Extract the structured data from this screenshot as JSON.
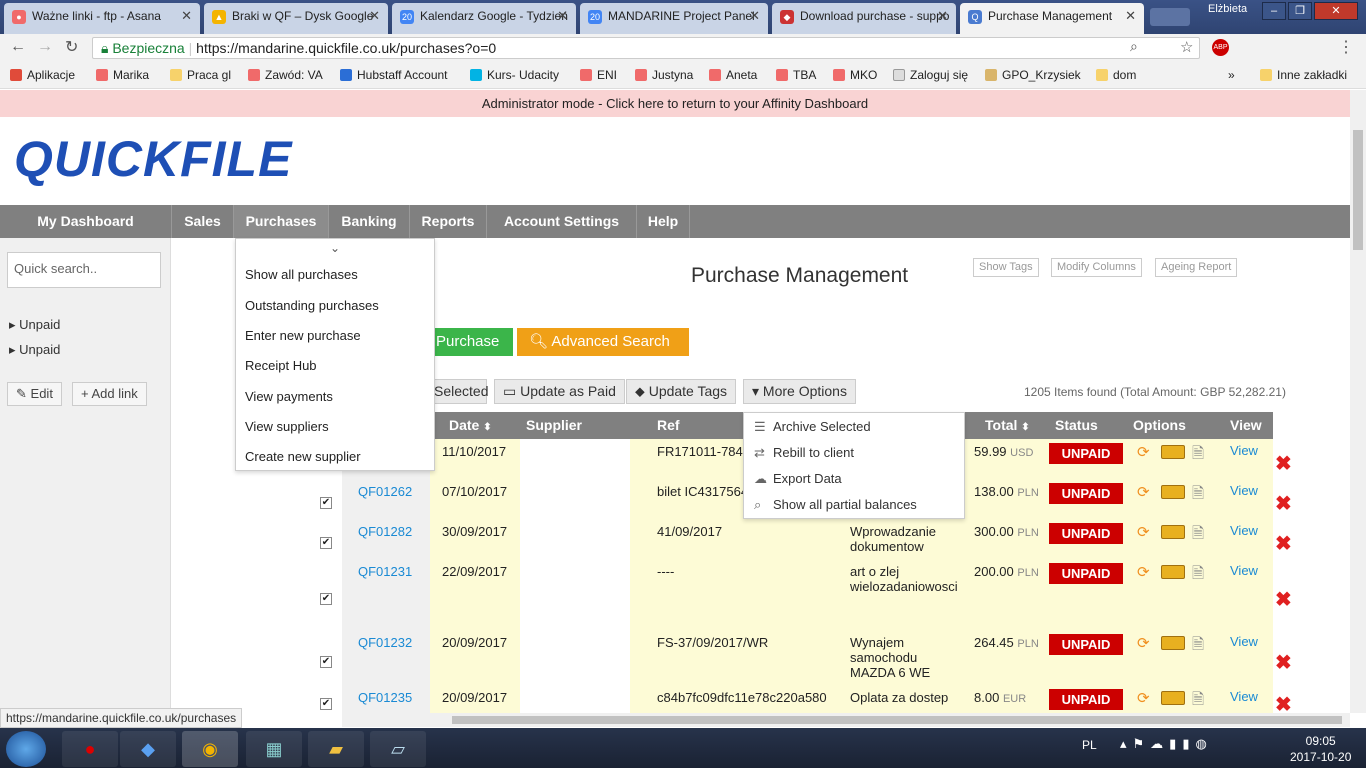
{
  "browser": {
    "tabs": [
      {
        "label": "Ważne linki - ftp - Asana",
        "color": "#f06a6a",
        "active": false
      },
      {
        "label": "Braki w QF – Dysk Google",
        "color": "#f4b400",
        "active": false
      },
      {
        "label": "Kalendarz Google - Tydzień",
        "color": "#4285f4",
        "active": false
      },
      {
        "label": "MANDARINE Project Panel",
        "color": "#4285f4",
        "active": false
      },
      {
        "label": "Download purchase - suppo",
        "color": "#cc3333",
        "active": false
      },
      {
        "label": "Purchase Management",
        "color": "#4a7bd0",
        "active": true
      }
    ],
    "user_label": "Elżbieta",
    "secure_label": "Bezpieczna",
    "url": "https://mandarine.quickfile.co.uk/purchases?o=0",
    "bookmarks": [
      "Aplikacje",
      "Marika",
      "Praca gl",
      "Zawód: VA",
      "Hubstaff Account",
      "Kurs- Udacity",
      "ENI",
      "Justyna",
      "Aneta",
      "TBA",
      "MKO",
      "Zaloguj się",
      "GPO_Krzysiek",
      "dom"
    ],
    "other_bookmarks": "Inne zakładki",
    "status_url": "https://mandarine.quickfile.co.uk/purchases"
  },
  "page": {
    "admin_banner": "Administrator mode - Click here to return to your Affinity Dashboard",
    "logo": "QUICKFILE",
    "nav": [
      "My Dashboard",
      "Sales",
      "Purchases",
      "Banking",
      "Reports",
      "Account Settings",
      "Help"
    ],
    "quick_search_placeholder": "Quick search..",
    "sidebar_links": [
      "Unpaid",
      "Unpaid"
    ],
    "edit_label": "Edit",
    "add_link_label": "Add link",
    "purchases_menu": [
      "Show all purchases",
      "Outstanding purchases",
      "Enter new purchase",
      "Receipt Hub",
      "View payments",
      "View suppliers",
      "Create new supplier"
    ],
    "title": "Purchase Management",
    "show_tags": "Show Tags",
    "modify_columns": "Modify Columns",
    "ageing_report": "Ageing Report",
    "new_purchase_btn": "Purchase",
    "advanced_search_btn": "Advanced Search",
    "toolbar": {
      "selected": "Selected",
      "update_paid": "Update as Paid",
      "update_tags": "Update Tags",
      "more_options": "More Options"
    },
    "items_found": "1205 Items found (Total Amount: GBP 52,282.21)",
    "more_menu": [
      "Archive Selected",
      "Rebill to client",
      "Export Data",
      "Show all partial balances"
    ],
    "columns": {
      "date": "Date",
      "supplier": "Supplier",
      "ref": "Ref",
      "total": "Total",
      "status": "Status",
      "options": "Options",
      "view": "View"
    },
    "rows": [
      {
        "id": "",
        "date": "11/10/2017",
        "ref": "FR171011-784",
        "desc": "",
        "amount": "59.99",
        "cur": "USD",
        "status": "UNPAID",
        "view": "View"
      },
      {
        "id": "QF01262",
        "date": "07/10/2017",
        "ref": "bilet IC4317564",
        "desc": "",
        "amount": "138.00",
        "cur": "PLN",
        "status": "UNPAID",
        "view": "View"
      },
      {
        "id": "QF01282",
        "date": "30/09/2017",
        "ref": "41/09/2017",
        "desc": "Wprowadzanie dokumentow",
        "amount": "300.00",
        "cur": "PLN",
        "status": "UNPAID",
        "view": "View"
      },
      {
        "id": "QF01231",
        "date": "22/09/2017",
        "ref": "----",
        "desc": "art o zlej wielozadaniowosci",
        "amount": "200.00",
        "cur": "PLN",
        "status": "UNPAID",
        "view": "View"
      },
      {
        "id": "QF01232",
        "date": "20/09/2017",
        "ref": "FS-37/09/2017/WR",
        "desc": "Wynajem samochodu MAZDA 6 WE",
        "amount": "264.45",
        "cur": "PLN",
        "status": "UNPAID",
        "view": "View"
      },
      {
        "id": "QF01235",
        "date": "20/09/2017",
        "ref": "c84b7fc09dfc11e78c220a580",
        "desc": "Oplata za dostep",
        "amount": "8.00",
        "cur": "EUR",
        "status": "UNPAID",
        "view": "View"
      }
    ]
  },
  "taskbar": {
    "lang": "PL",
    "time": "09:05",
    "date": "2017-10-20"
  }
}
